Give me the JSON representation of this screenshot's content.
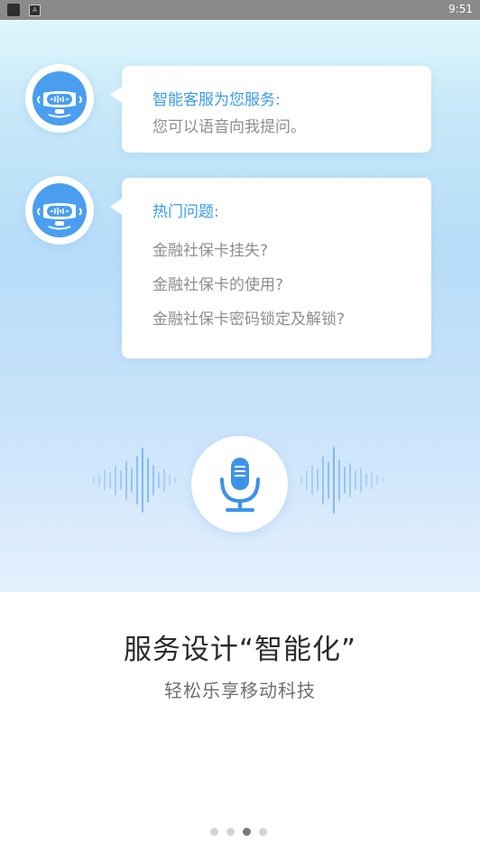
{
  "status_bar": {
    "time": "9:51",
    "icon2_letter": "A"
  },
  "chat": {
    "message1": {
      "title": "智能客服为您服务:",
      "text": "您可以语音向我提问。"
    },
    "message2": {
      "title": "热门问题:",
      "questions": [
        "金融社保卡挂失?",
        "金融社保卡的使用?",
        "金融社保卡密码锁定及解锁?"
      ]
    }
  },
  "voice": {
    "icon": "microphone-icon"
  },
  "feature": {
    "title": "服务设计“智能化”",
    "subtitle": "轻松乐享移动科技"
  },
  "pager": {
    "total": 4,
    "active": 3
  },
  "colors": {
    "accent": "#3a9bec",
    "robot_blue": "#4a9ef0",
    "mic_blue": "#3d93e8"
  }
}
